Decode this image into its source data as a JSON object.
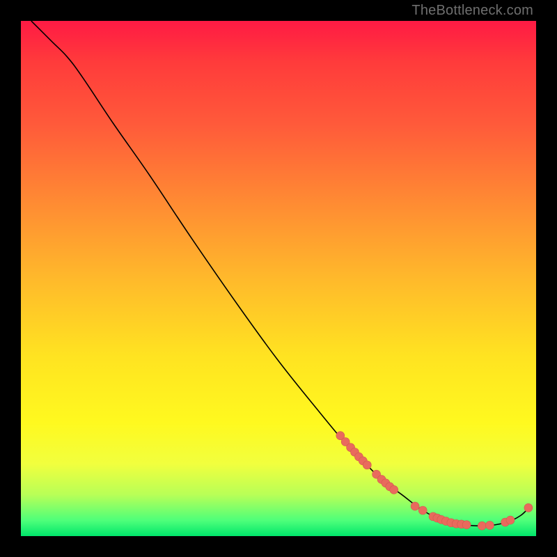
{
  "watermark": "TheBottleneck.com",
  "chart_data": {
    "type": "line",
    "title": "",
    "xlabel": "",
    "ylabel": "",
    "xlim": [
      0,
      100
    ],
    "ylim": [
      0,
      100
    ],
    "grid": false,
    "curve": [
      {
        "x": 2,
        "y": 100
      },
      {
        "x": 6,
        "y": 96
      },
      {
        "x": 9,
        "y": 93
      },
      {
        "x": 12,
        "y": 89
      },
      {
        "x": 18,
        "y": 80
      },
      {
        "x": 25,
        "y": 70
      },
      {
        "x": 33,
        "y": 58
      },
      {
        "x": 42,
        "y": 45
      },
      {
        "x": 50,
        "y": 34
      },
      {
        "x": 58,
        "y": 24
      },
      {
        "x": 63,
        "y": 18
      },
      {
        "x": 66,
        "y": 15
      },
      {
        "x": 70,
        "y": 11
      },
      {
        "x": 74,
        "y": 8
      },
      {
        "x": 78,
        "y": 5
      },
      {
        "x": 82,
        "y": 3
      },
      {
        "x": 86,
        "y": 2.2
      },
      {
        "x": 90,
        "y": 2
      },
      {
        "x": 94,
        "y": 2.6
      },
      {
        "x": 97,
        "y": 4
      },
      {
        "x": 99,
        "y": 6
      }
    ],
    "markers": [
      {
        "x": 62.0,
        "y": 19.5
      },
      {
        "x": 63.0,
        "y": 18.3
      },
      {
        "x": 64.0,
        "y": 17.2
      },
      {
        "x": 64.8,
        "y": 16.3
      },
      {
        "x": 65.6,
        "y": 15.4
      },
      {
        "x": 66.4,
        "y": 14.6
      },
      {
        "x": 67.2,
        "y": 13.8
      },
      {
        "x": 69.0,
        "y": 12.0
      },
      {
        "x": 70.0,
        "y": 11.0
      },
      {
        "x": 70.8,
        "y": 10.3
      },
      {
        "x": 71.6,
        "y": 9.6
      },
      {
        "x": 72.4,
        "y": 9.0
      },
      {
        "x": 76.5,
        "y": 5.8
      },
      {
        "x": 78.0,
        "y": 5.0
      },
      {
        "x": 80.0,
        "y": 3.8
      },
      {
        "x": 80.8,
        "y": 3.5
      },
      {
        "x": 81.6,
        "y": 3.2
      },
      {
        "x": 82.5,
        "y": 2.9
      },
      {
        "x": 83.5,
        "y": 2.6
      },
      {
        "x": 84.5,
        "y": 2.4
      },
      {
        "x": 85.5,
        "y": 2.3
      },
      {
        "x": 86.5,
        "y": 2.2
      },
      {
        "x": 89.5,
        "y": 2.0
      },
      {
        "x": 91.0,
        "y": 2.1
      },
      {
        "x": 94.0,
        "y": 2.7
      },
      {
        "x": 95.0,
        "y": 3.1
      },
      {
        "x": 98.5,
        "y": 5.5
      }
    ],
    "colors": {
      "curve": "#000000",
      "marker": "#e96a5d"
    }
  }
}
